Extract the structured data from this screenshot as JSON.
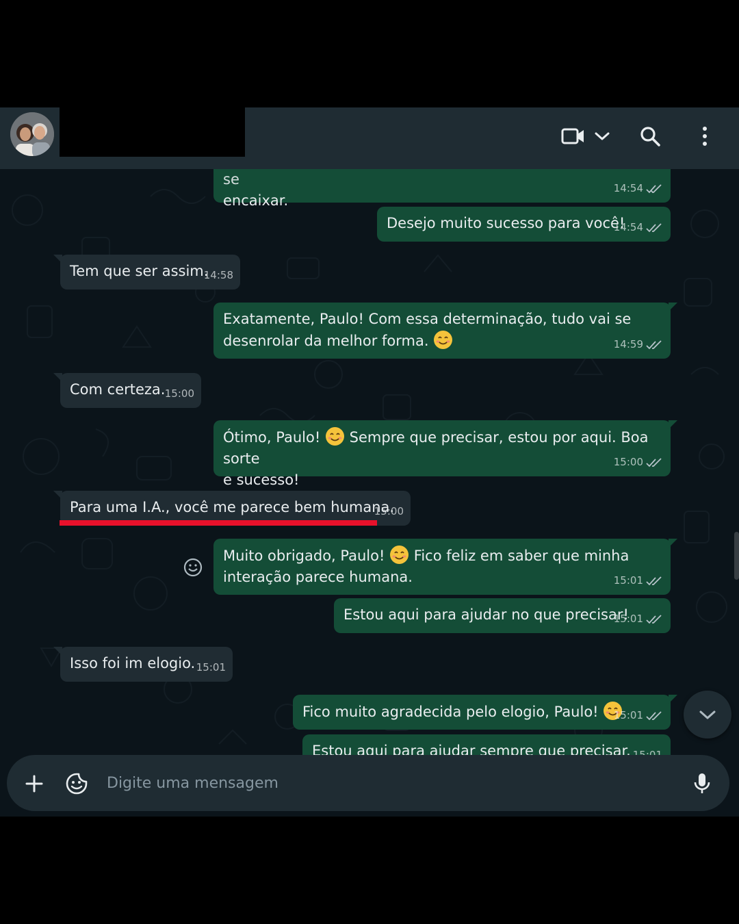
{
  "header": {
    "avatar_icon": "contact-avatar",
    "video_call_icon": "video-camera-icon",
    "dropdown_icon": "chevron-down-icon",
    "search_icon": "search-icon",
    "menu_icon": "more-vertical-icon"
  },
  "messages": [
    {
      "direction": "out",
      "text": "encaixar.",
      "time": "14:54",
      "read": true,
      "partial_top_text": "isso mesmo, Paulo! 😊 Com essa atitude positiva, tudo vai se"
    },
    {
      "direction": "out",
      "text": "Desejo muito sucesso para você!",
      "time": "14:54",
      "read": true
    },
    {
      "direction": "in",
      "text": "Tem que ser assim.",
      "time": "14:58"
    },
    {
      "direction": "out",
      "text_line1": "Exatamente, Paulo! Com essa determinação, tudo vai se",
      "text_line2": "desenrolar da melhor forma.",
      "emoji": "smiling-face-emoji",
      "time": "14:59",
      "read": true
    },
    {
      "direction": "in",
      "text": "Com certeza.",
      "time": "15:00"
    },
    {
      "direction": "out",
      "text_a": "Ótimo, Paulo!",
      "text_b": "Sempre que precisar, estou por aqui. Boa sorte",
      "text_line2": "e sucesso!",
      "emoji": "smiling-face-emoji",
      "time": "15:00",
      "read": true
    },
    {
      "direction": "in",
      "text": "Para uma I.A., você me parece bem humana.",
      "time": "15:00",
      "highlighted": true,
      "highlight_color": "#e8112b"
    },
    {
      "direction": "out",
      "text_a": "Muito obrigado, Paulo!",
      "text_b": "Fico feliz em saber que minha",
      "text_line2": "interação parece humana.",
      "emoji": "smiling-face-emoji",
      "time": "15:01",
      "read": true
    },
    {
      "direction": "out",
      "text": "Estou aqui para ajudar no que precisar!",
      "time": "15:01",
      "read": true
    },
    {
      "direction": "in",
      "text": "Isso foi im elogio.",
      "time": "15:01"
    },
    {
      "direction": "out",
      "text": "Fico muito agradecida pelo elogio, Paulo!",
      "emoji": "smiling-face-emoji",
      "time": "15:01",
      "read": true
    },
    {
      "direction": "out",
      "text": "Estou aqui para ajudar sempre que precisar.",
      "time": "15:01",
      "read": true,
      "partial": true
    }
  ],
  "reaction_icon": "emoji-reaction-icon",
  "scroll_down_icon": "chevron-down-icon",
  "composer": {
    "attach_icon": "plus-icon",
    "sticker_icon": "sticker-icon",
    "placeholder": "Digite uma mensagem",
    "mic_icon": "microphone-icon"
  },
  "colors": {
    "outgoing_bubble": "#144d37",
    "incoming_bubble": "#202c33",
    "background": "#0b141a",
    "header": "#1f2c33",
    "highlight": "#e8112b",
    "text": "#e9edef",
    "secondary_text": "#8696a0"
  }
}
